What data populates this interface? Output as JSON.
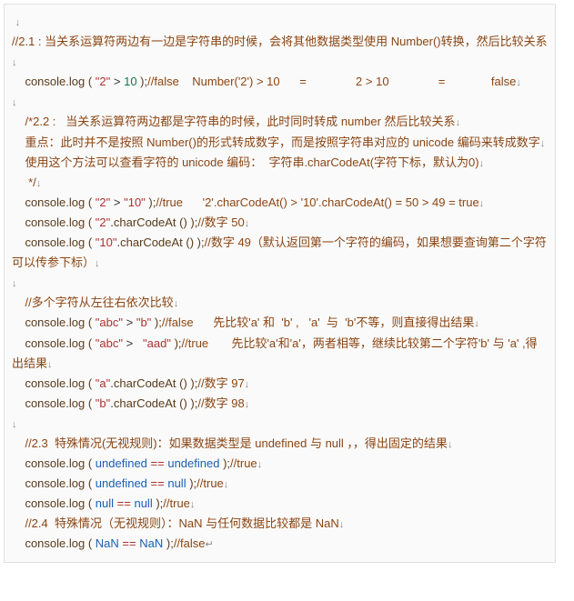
{
  "marks": {
    "arrow": "↓",
    "enter": "↵"
  },
  "lines": {
    "l0": "",
    "c21a": "//2.1 : 当关系运算符两边有一边是字符串的时候，会将其他数据类型使用 Number()转换，然后比较关系",
    "log": "console.log",
    "charCodeAt": "charCodeAt",
    "s2": "\"2\"",
    "n10": "10",
    "c21b": "//false    Number('2') > 10      =               2 > 10               =              false",
    "c22a": "/*2.2 :   当关系运算符两边都是字符串的时候，此时同时转成 number 然后比较关系",
    "c22b": "重点：此时并不是按照 Number()的形式转成数字，而是按照字符串对应的 unicode 编码来转成数字",
    "c22c": "使用这个方法可以查看字符的 unicode 编码：  字符串.charCodeAt(字符下标，默认为0)",
    "c22d": "*/",
    "s10": "\"10\"",
    "c_true50": "//true      '2'.charCodeAt() > '10'.charCodeAt() = 50 > 49 = true",
    "c_n50": "//数字 50",
    "c_n49": "//数字 49（默认返回第一个字符的编码，如果想要查询第二个字符可以传参下标）",
    "c_multi": "//多个字符从左往右依次比较",
    "sabc": "\"abc\"",
    "sb": "\"b\"",
    "c_abc_b": "//false      先比较'a' 和  'b' ,   'a'  与  'b'不等，则直接得出结果",
    "saad": "\"aad\"",
    "c_abc_aad": "//true       先比较'a'和'a'，两者相等，继续比较第二个字符'b' 与 'a' ,得出结果",
    "sa": "\"a\"",
    "c_n97": "//数字 97",
    "sbb": "\"b\"",
    "c_n98": "//数字 98",
    "c23": "//2.3  特殊情况(无视规则)：如果数据类型是 undefined 与 null ，，得出固定的结果",
    "undef": "undefined",
    "null": "null",
    "nan": "NaN",
    "ctrue": "//true",
    "cfalse": "//false",
    "c24": "//2.4  特殊情况（无视规则）：NaN 与任何数据比较都是 NaN"
  }
}
